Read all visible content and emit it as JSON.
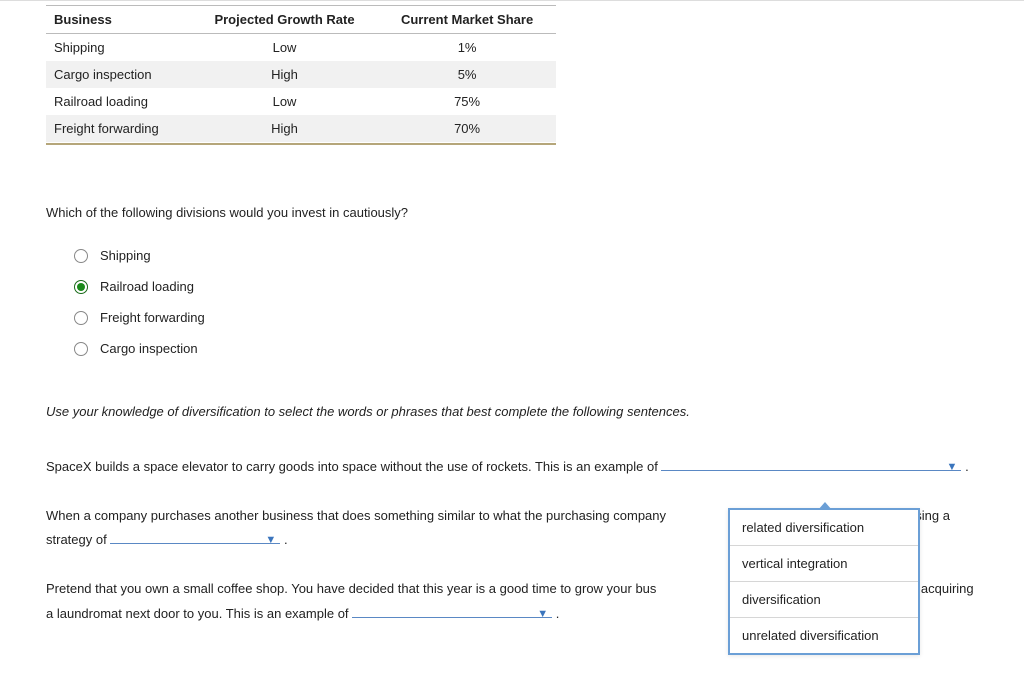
{
  "table": {
    "headers": [
      "Business",
      "Projected Growth Rate",
      "Current Market Share"
    ],
    "rows": [
      {
        "business": "Shipping",
        "rate": "Low",
        "share": "1%"
      },
      {
        "business": "Cargo inspection",
        "rate": "High",
        "share": "5%"
      },
      {
        "business": "Railroad loading",
        "rate": "Low",
        "share": "75%"
      },
      {
        "business": "Freight forwarding",
        "rate": "High",
        "share": "70%"
      }
    ]
  },
  "question1": {
    "prompt": "Which of the following divisions would you invest in cautiously?",
    "options": [
      "Shipping",
      "Railroad loading",
      "Freight forwarding",
      "Cargo inspection"
    ],
    "selected_index": 1
  },
  "instruction": "Use your knowledge of diversification to select the words or phrases that best complete the following sentences.",
  "sentence1_a": "SpaceX builds a space elevator to carry goods into space without the use of rockets. This is an example of ",
  "sentence1_b": " .",
  "sentence2_a": "When a company purchases another business that does something similar to what the purchasing company",
  "sentence2_b": "pany is using a strategy of ",
  "sentence2_c": " .",
  "sentence3_a": "Pretend that you own a small coffee shop. You have decided that this year is a good time to grow your bus",
  "sentence3_b": " to do so by acquiring a laundromat next door to you. This is an example of ",
  "sentence3_c": " .",
  "dropdown": {
    "items": [
      "related diversification",
      "vertical integration",
      "diversification",
      "unrelated diversification"
    ]
  }
}
